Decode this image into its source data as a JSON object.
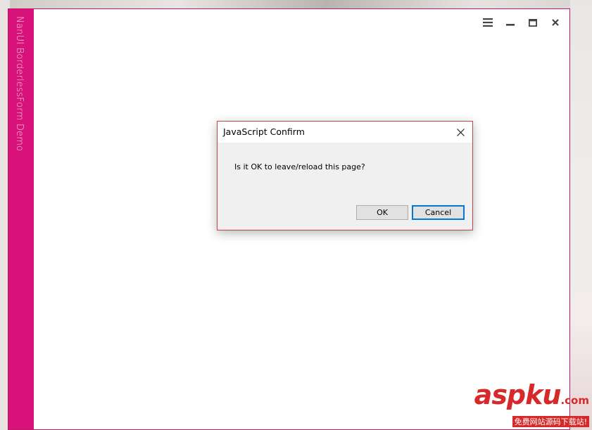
{
  "window": {
    "sidebar_title": "NanUI BorderlessForm Demo",
    "controls": [
      {
        "name": "menu",
        "icon": "hamburger-menu-icon"
      },
      {
        "name": "minimize",
        "icon": "minimize-icon"
      },
      {
        "name": "maximize",
        "icon": "maximize-icon"
      },
      {
        "name": "close",
        "icon": "close-icon"
      }
    ],
    "accent_color": "#d7127a"
  },
  "dialog": {
    "title": "JavaScript Confirm",
    "message": "Is it OK to leave/reload this page?",
    "ok_label": "OK",
    "cancel_label": "Cancel",
    "close_icon": "close-icon"
  },
  "watermark": {
    "logo": "aspku",
    "domain": ".com",
    "tagline": "免费网站源码下载站!"
  }
}
